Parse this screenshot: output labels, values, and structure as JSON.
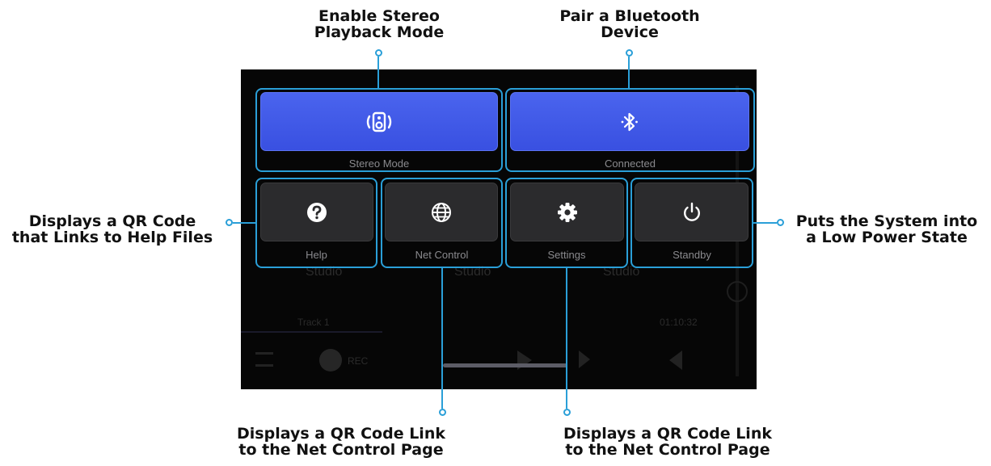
{
  "callouts": {
    "stereo": {
      "line1": "Enable Stereo",
      "line2": "Playback Mode"
    },
    "bluetooth": {
      "line1": "Pair a Bluetooth",
      "line2": "Device"
    },
    "help": {
      "line1": "Displays a QR Code",
      "line2": "that Links to Help Files"
    },
    "standby": {
      "line1": "Puts the System into",
      "line2": "a Low Power State"
    },
    "net_control": {
      "line1": "Displays a QR Code Link",
      "line2": "to the Net Control Page"
    },
    "settings": {
      "line1": "Displays a QR Code Link",
      "line2": "to the Net Control Page"
    }
  },
  "buttons": {
    "stereo": {
      "label": "Stereo Mode",
      "icon": "speaker-icon",
      "active": true
    },
    "bluetooth": {
      "label": "Connected",
      "icon": "bluetooth-icon",
      "active": true
    },
    "help": {
      "label": "Help",
      "icon": "question-icon"
    },
    "net_control": {
      "label": "Net Control",
      "icon": "globe-icon"
    },
    "settings": {
      "label": "Settings",
      "icon": "gear-icon"
    },
    "standby": {
      "label": "Standby",
      "icon": "power-icon"
    }
  },
  "background": {
    "studio_labels": [
      "Studio",
      "Studio",
      "Studio"
    ],
    "track_name": "Track 1",
    "time": "01:10:32",
    "rec_label": "REC"
  },
  "colors": {
    "accent": "#2a9fd8",
    "button_blue": "#4a64ee",
    "button_dark": "#2b2b2d",
    "screen_bg": "#060606"
  }
}
